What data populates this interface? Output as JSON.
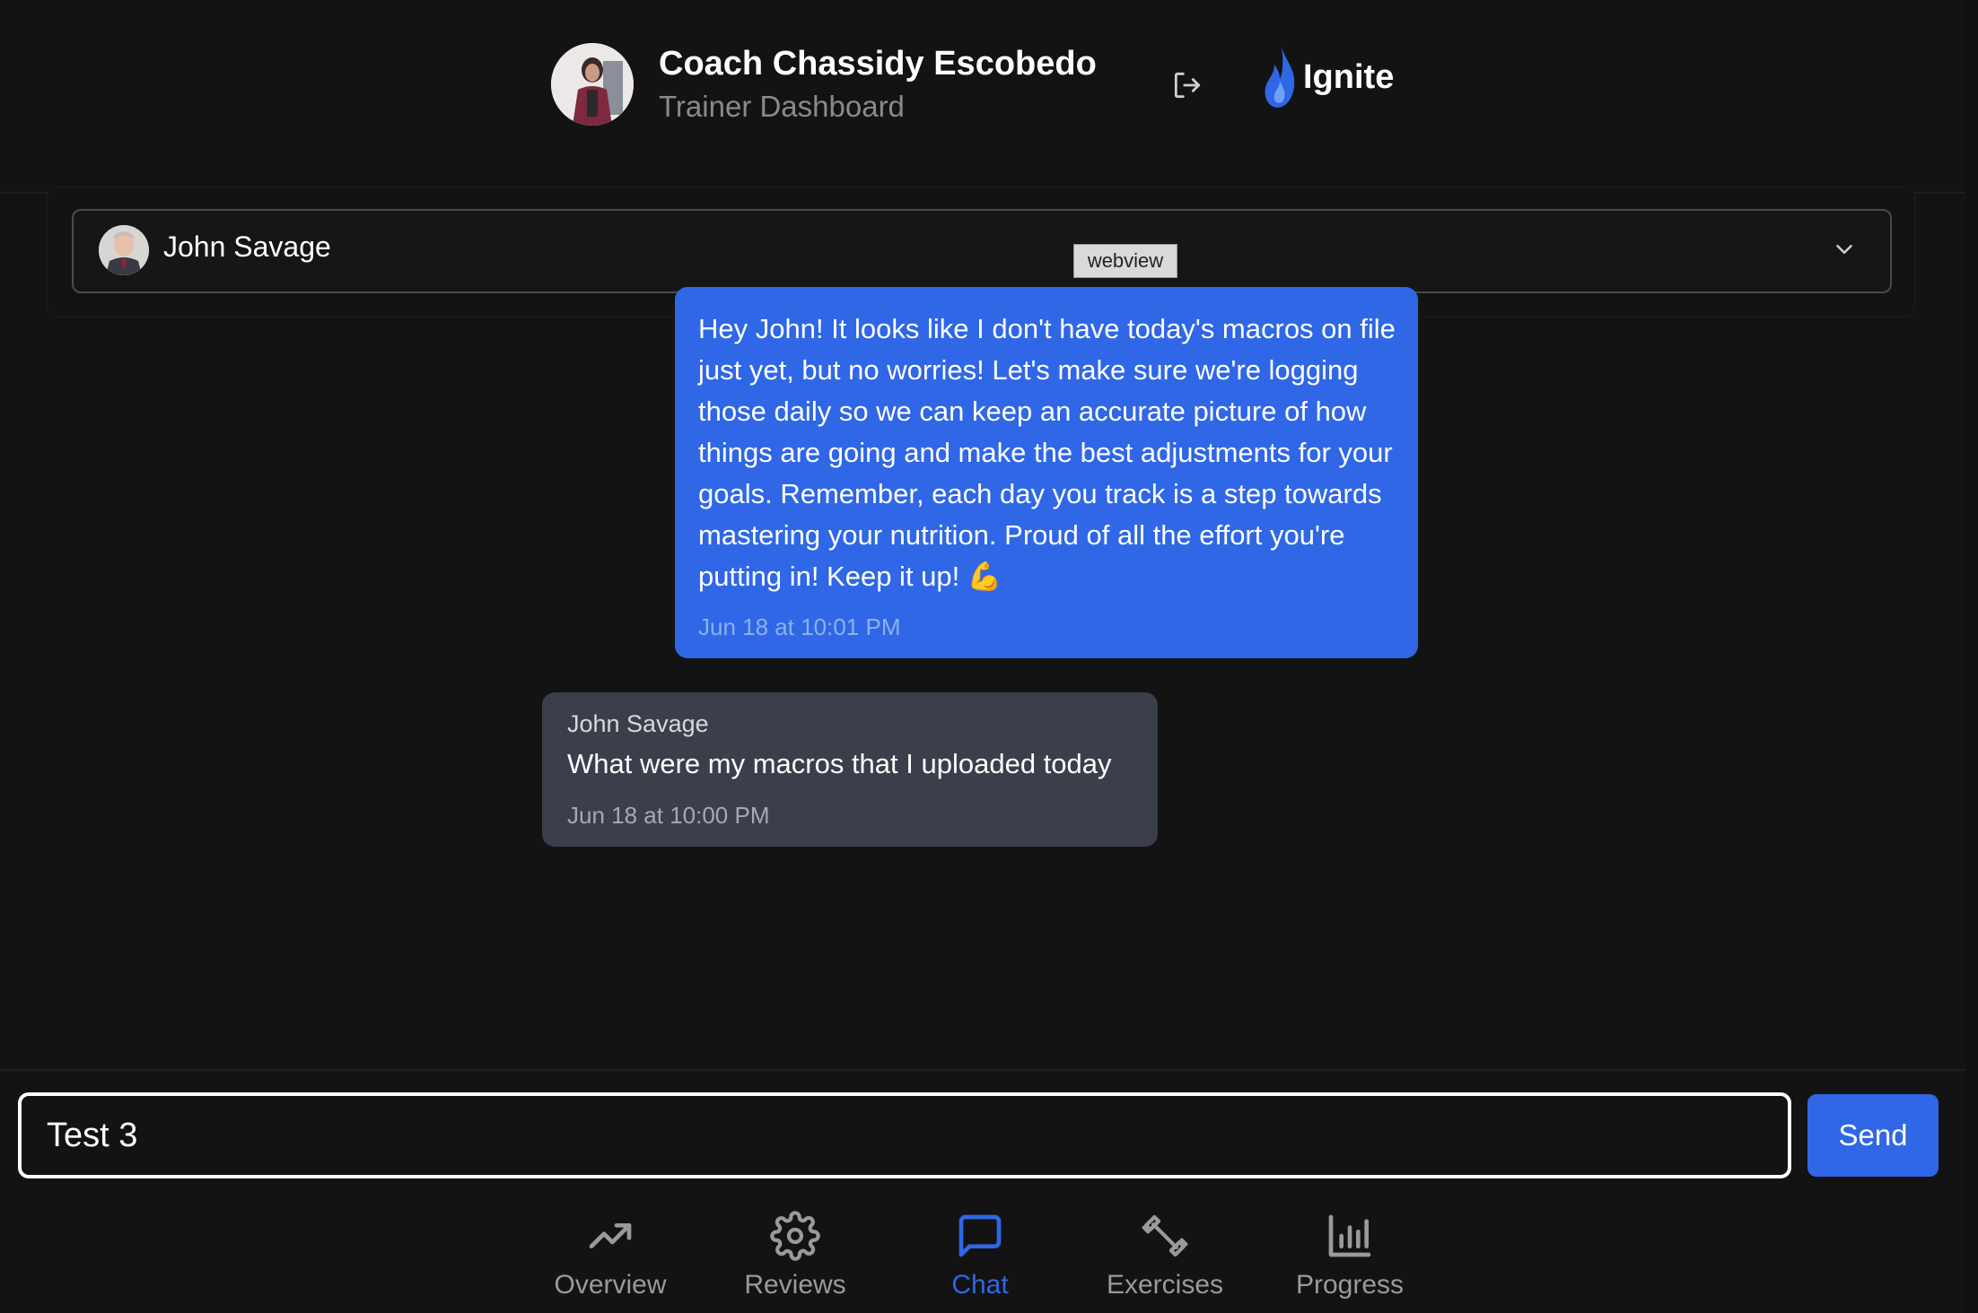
{
  "header": {
    "coach_name": "Coach Chassidy Escobedo",
    "subtitle": "Trainer Dashboard",
    "brand": "Ignite",
    "accent_color": "#2f67e6"
  },
  "client_selector": {
    "selected": "John Savage",
    "badge": "webview"
  },
  "messages": [
    {
      "sender": "",
      "text": "Hey John! It looks like I don't have today's macros on file just yet, but no worries! Let's make sure we're logging those daily so we can keep an accurate picture of how things are going and make the best adjustments for your goals. Remember, each day you track is a step towards mastering your nutrition. Proud of all the effort you're putting in! Keep it up! 💪",
      "time": "Jun 18 at 10:01 PM"
    },
    {
      "sender": "John Savage",
      "text": "What were my macros that I uploaded today",
      "time": "Jun 18 at 10:00 PM"
    }
  ],
  "composer": {
    "value": "Test 3",
    "send_label": "Send"
  },
  "tabs": [
    {
      "label": "Overview",
      "icon": "trending-up-icon"
    },
    {
      "label": "Reviews",
      "icon": "gear-icon"
    },
    {
      "label": "Chat",
      "icon": "chat-icon",
      "active": true
    },
    {
      "label": "Exercises",
      "icon": "dumbbell-icon"
    },
    {
      "label": "Progress",
      "icon": "bar-chart-icon"
    }
  ]
}
